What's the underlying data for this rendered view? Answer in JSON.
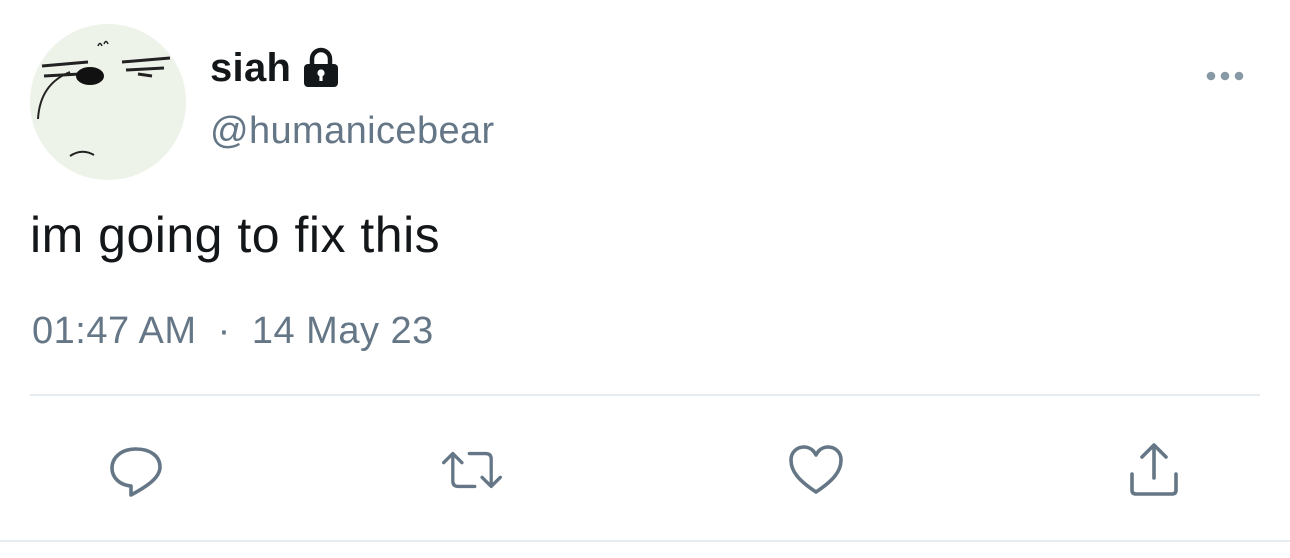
{
  "user": {
    "display_name": "siah",
    "handle": "@humanicebear",
    "protected_icon": "lock-icon",
    "avatar": "avatar-image"
  },
  "tweet": {
    "text": "im going to fix this",
    "time": "01:47 AM",
    "separator": "·",
    "date": "14 May 23"
  },
  "menu": {
    "icon": "more-options-icon"
  },
  "actions": [
    {
      "name": "reply",
      "icon": "reply-icon"
    },
    {
      "name": "retweet",
      "icon": "retweet-icon"
    },
    {
      "name": "like",
      "icon": "heart-icon"
    },
    {
      "name": "share",
      "icon": "share-icon"
    }
  ],
  "colors": {
    "text_primary": "#14171a",
    "text_secondary": "#657786",
    "divider": "#e6ecf0",
    "avatar_bg": "#eef3ea"
  }
}
